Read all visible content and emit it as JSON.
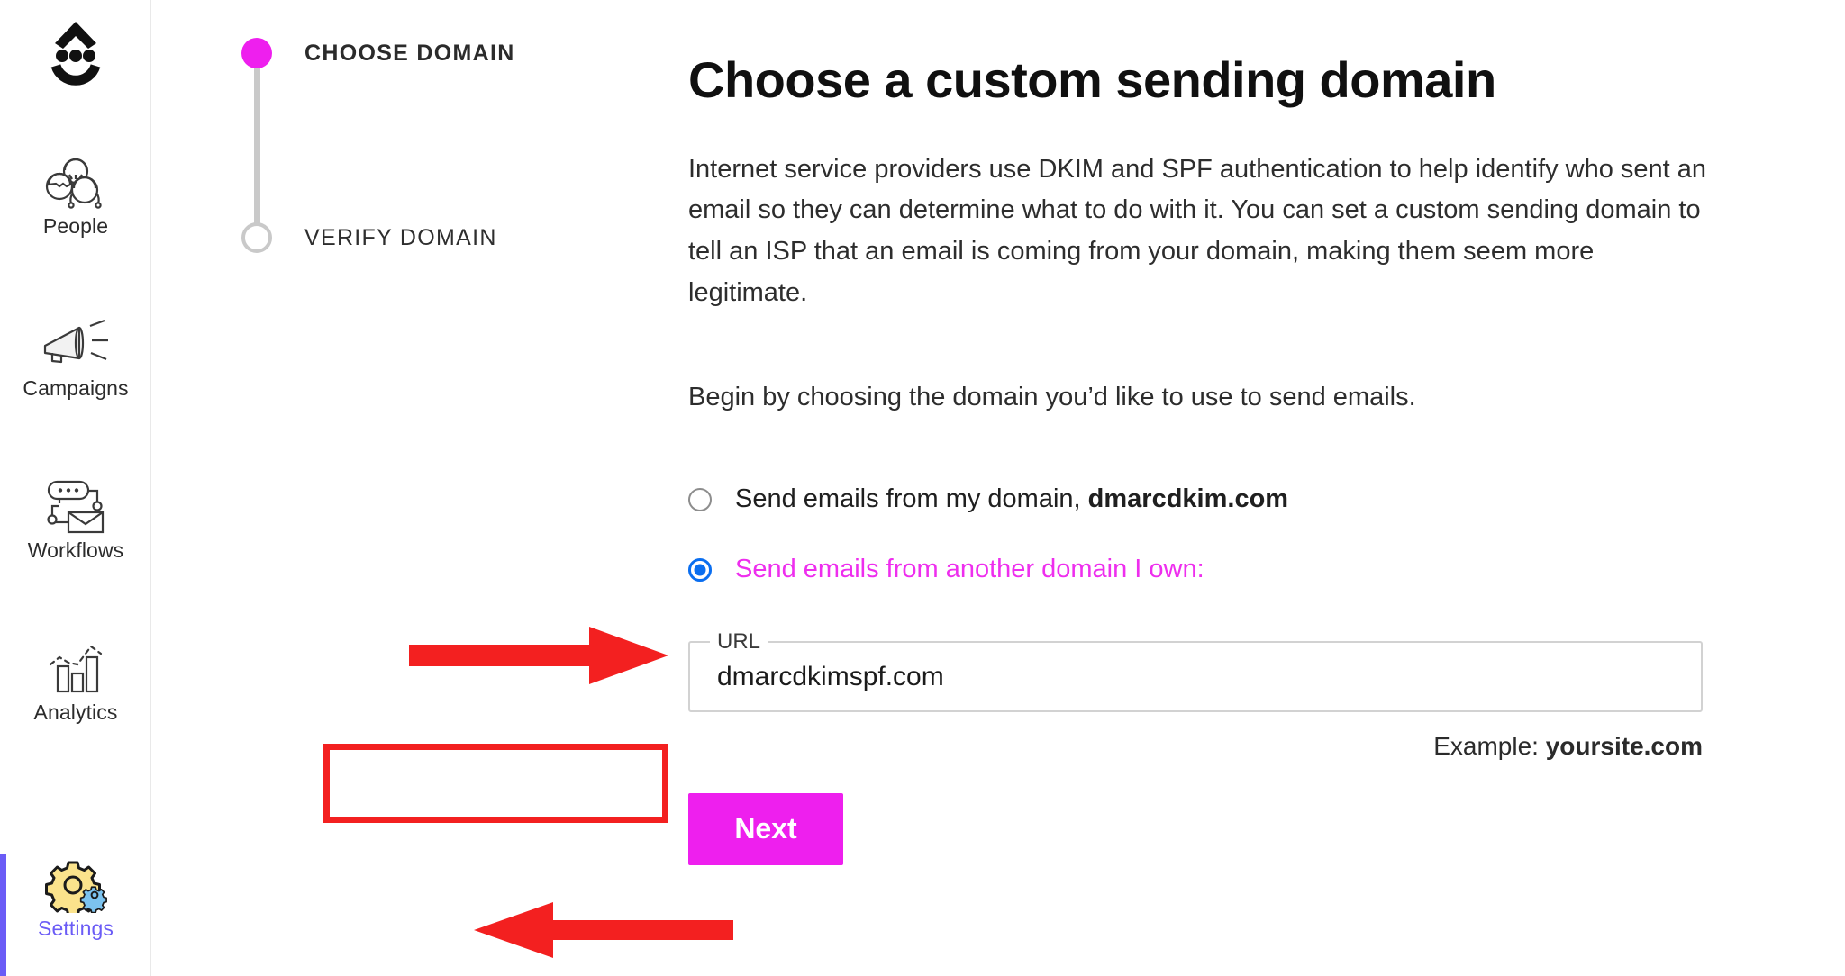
{
  "sidebar": {
    "brand": {
      "icon": "smiley-face-logo"
    },
    "items": [
      {
        "label": "People",
        "icon": "people-icon",
        "active": false
      },
      {
        "label": "Campaigns",
        "icon": "megaphone-icon",
        "active": false
      },
      {
        "label": "Workflows",
        "icon": "workflow-icon",
        "active": false
      },
      {
        "label": "Analytics",
        "icon": "bar-chart-icon",
        "active": false
      },
      {
        "label": "Settings",
        "icon": "gear-icon",
        "active": true
      }
    ],
    "active_color": "#6b5cf6"
  },
  "stepper": {
    "steps": [
      {
        "label": "CHOOSE DOMAIN",
        "state": "current"
      },
      {
        "label": "VERIFY DOMAIN",
        "state": "upcoming"
      }
    ],
    "current_color": "#ee1fee",
    "upcoming_color": "#c9c9c9"
  },
  "main": {
    "title": "Choose a custom sending domain",
    "paragraph1": "Internet service providers use DKIM and SPF authentication to help identify who sent an email so they can determine what to do with it. You can set a custom sending domain to tell an ISP that an email is coming from your domain, making them seem more legitimate.",
    "paragraph2": "Begin by choosing the domain you’d like to use to send emails.",
    "options": [
      {
        "text_prefix": "Send emails from my domain, ",
        "domain": "dmarcdkim.com",
        "selected": false
      },
      {
        "text_prefix": "Send emails from another domain I own:",
        "domain": "",
        "selected": true
      }
    ],
    "url_field": {
      "legend": "URL",
      "value": "dmarcdkimspf.com",
      "placeholder": "yoursite.com"
    },
    "example_prefix": "Example: ",
    "example_domain": "yoursite.com",
    "next_label": "Next",
    "accent_color": "#ee1fee",
    "radio_selected_color": "#0a6ef0",
    "highlight_color": "#ee2eee"
  },
  "annotations": {
    "color": "#f32020",
    "items": [
      {
        "name": "arrow-to-selected-radio",
        "direction": "right"
      },
      {
        "name": "arrow-to-next-button",
        "direction": "left"
      },
      {
        "name": "highlight-box-url-value",
        "shape": "rectangle"
      }
    ]
  }
}
